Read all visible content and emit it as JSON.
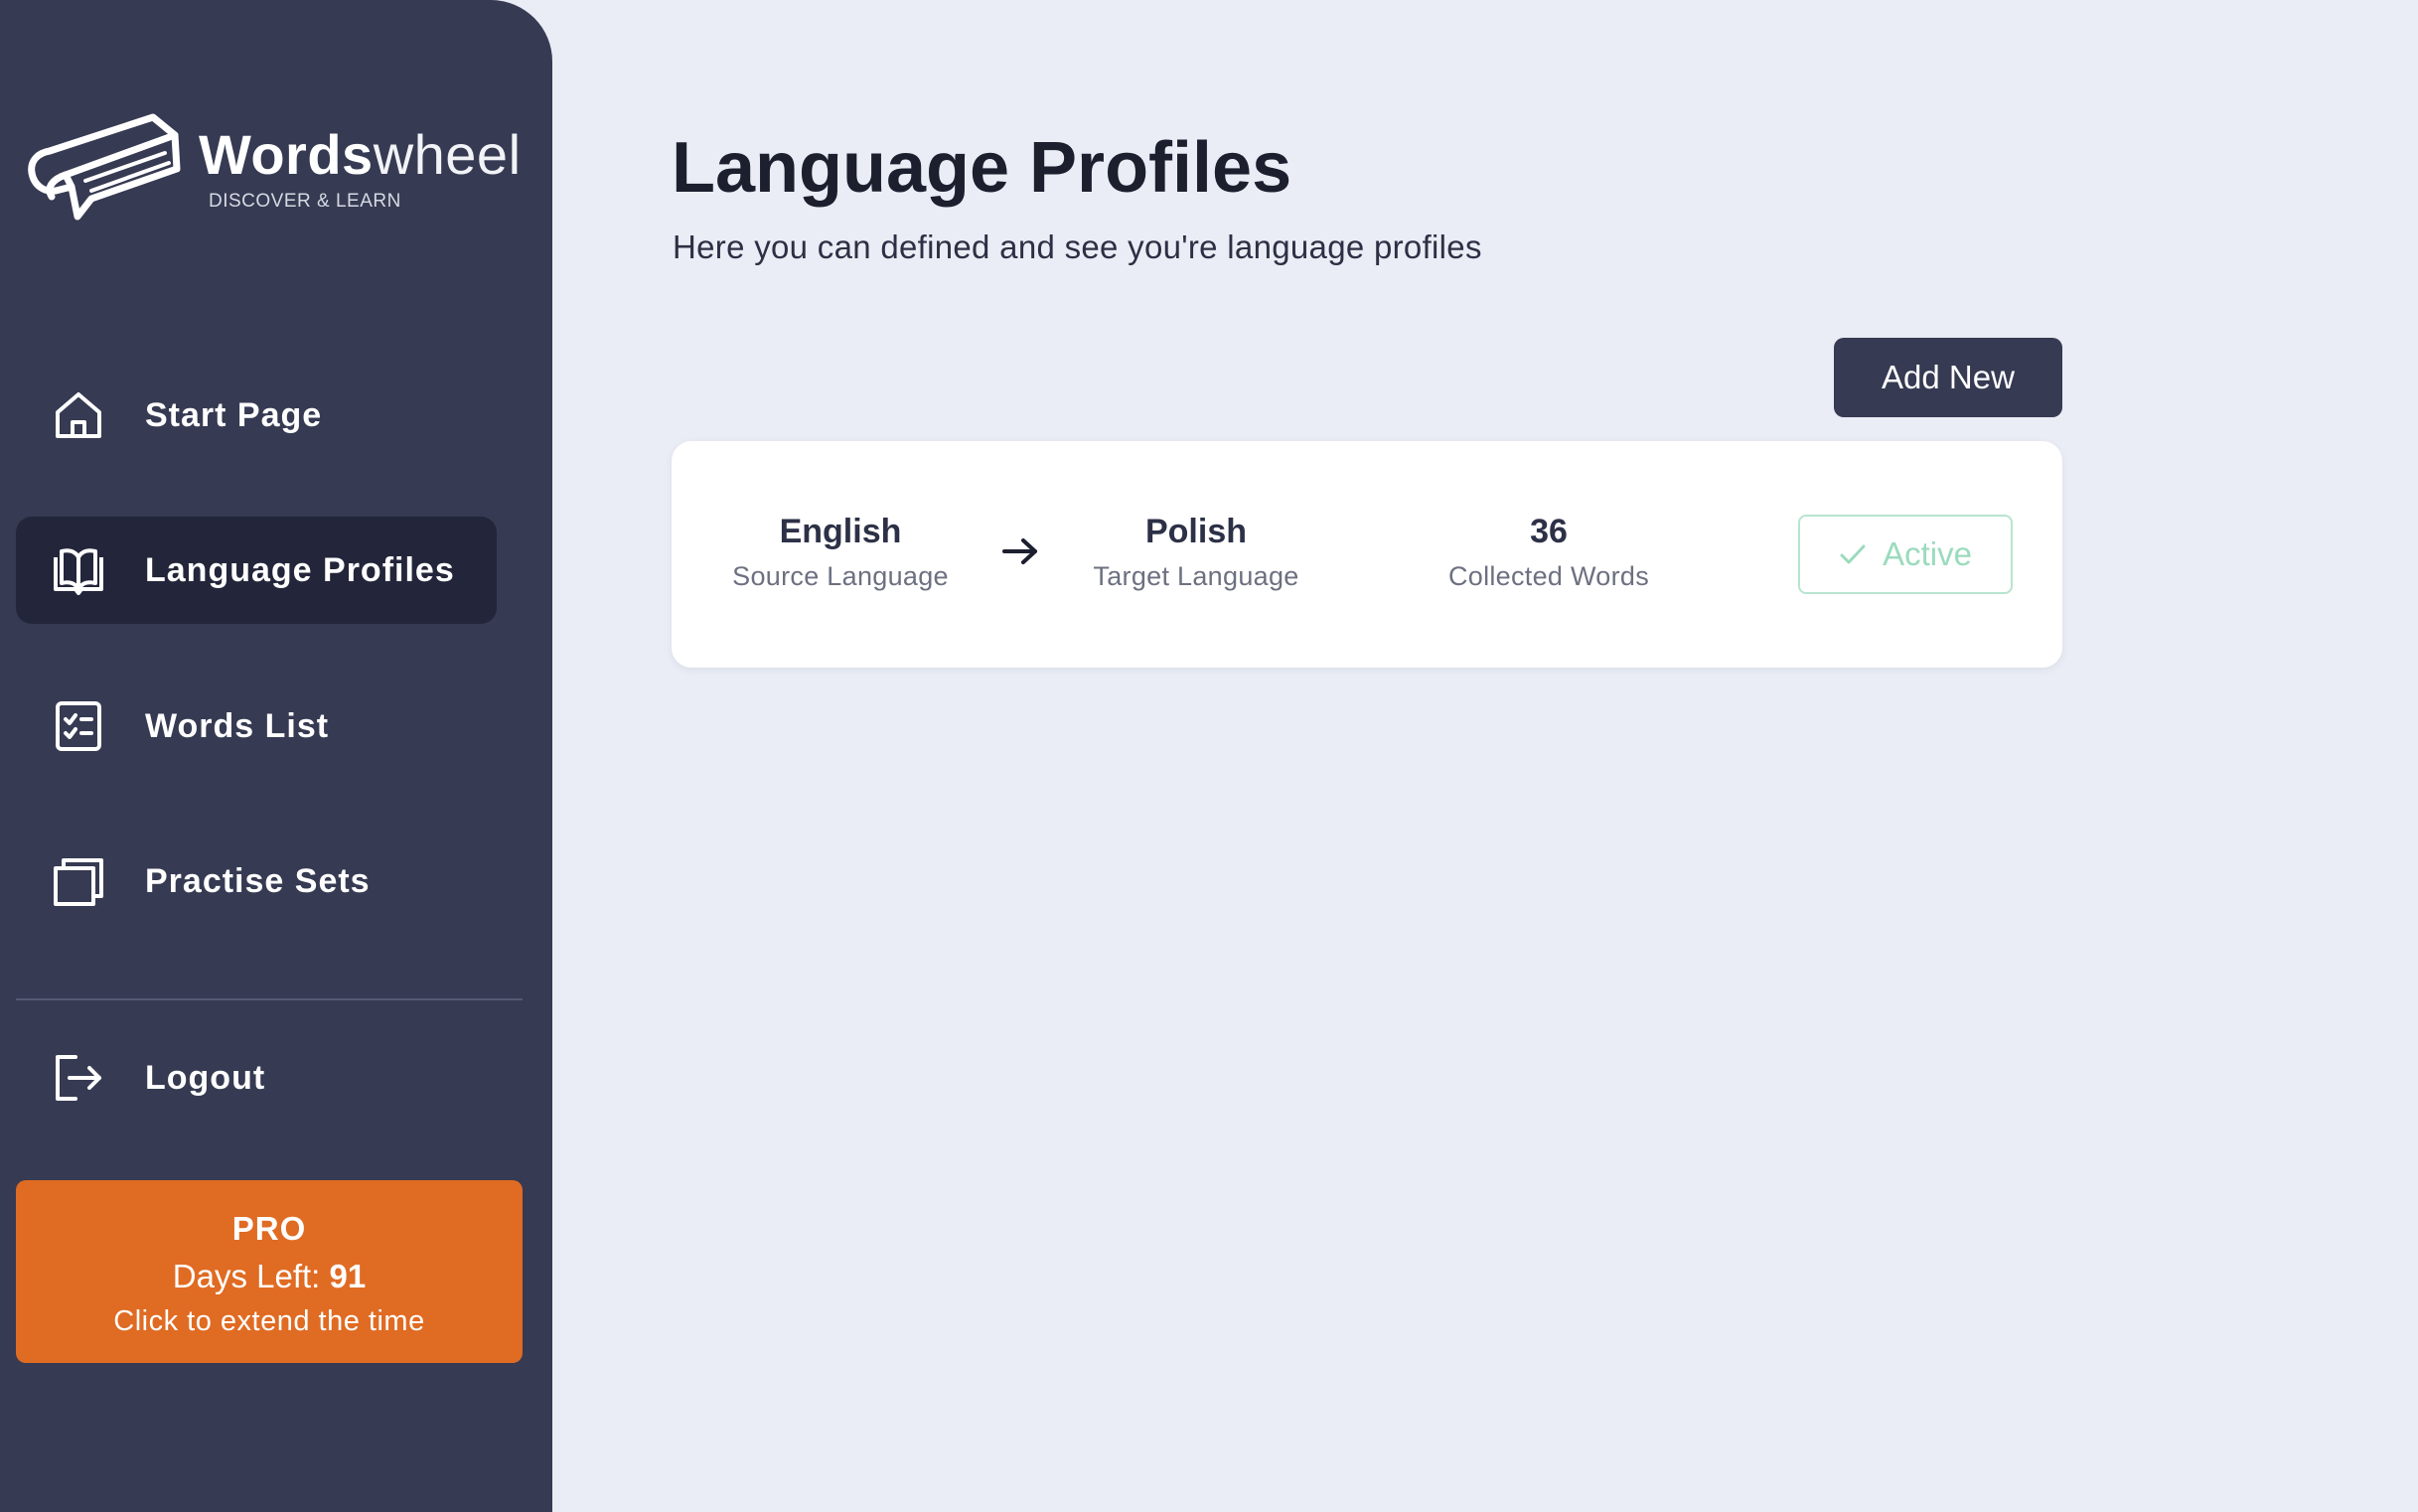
{
  "brand": {
    "name_bold": "Words",
    "name_light": "wheel",
    "tagline": "DISCOVER & LEARN"
  },
  "sidebar": {
    "items": [
      {
        "label": "Start Page",
        "icon": "home-icon",
        "active": false
      },
      {
        "label": "Language Profiles",
        "icon": "open-book-icon",
        "active": true
      },
      {
        "label": "Words List",
        "icon": "checklist-icon",
        "active": false
      },
      {
        "label": "Practise Sets",
        "icon": "stacked-cards-icon",
        "active": false
      }
    ],
    "logout": {
      "label": "Logout",
      "icon": "logout-icon"
    },
    "pro": {
      "title": "PRO",
      "days_left_label": "Days Left:",
      "days_left_value": "91",
      "extend_text": "Click to extend the time"
    }
  },
  "main": {
    "title": "Language Profiles",
    "subtitle": "Here you can defined and see you're language profiles",
    "add_new_label": "Add New",
    "profiles": [
      {
        "source_language": "English",
        "source_language_label": "Source Language",
        "target_language": "Polish",
        "target_language_label": "Target Language",
        "collected_words": "36",
        "collected_words_label": "Collected Words",
        "status_label": "Active"
      }
    ]
  },
  "colors": {
    "sidebar_bg": "#363a52",
    "sidebar_active_bg": "#23263a",
    "page_bg": "#eaedf5",
    "pro_card": "#e06b22",
    "active_green": "#9bdbbd"
  }
}
